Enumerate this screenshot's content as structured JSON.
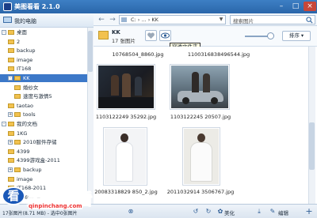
{
  "window": {
    "title": "美图看看 2.1.0"
  },
  "sidebar": {
    "header": "我的电脑",
    "items": [
      {
        "label": "桌面",
        "level": 0,
        "expander": "-"
      },
      {
        "label": "2",
        "level": 1,
        "expander": ""
      },
      {
        "label": "backup",
        "level": 1,
        "expander": ""
      },
      {
        "label": "image",
        "level": 1,
        "expander": ""
      },
      {
        "label": "IT168",
        "level": 1,
        "expander": ""
      },
      {
        "label": "KK",
        "level": 1,
        "expander": "-",
        "selected": true
      },
      {
        "label": "婚纱女",
        "level": 2,
        "expander": ""
      },
      {
        "label": "速度与激情5",
        "level": 2,
        "expander": ""
      },
      {
        "label": "taotao",
        "level": 1,
        "expander": ""
      },
      {
        "label": "tools",
        "level": 1,
        "expander": "+"
      },
      {
        "label": "我的文档",
        "level": 0,
        "expander": "-"
      },
      {
        "label": "1KG",
        "level": 1,
        "expander": ""
      },
      {
        "label": "2010服件存储",
        "level": 1,
        "expander": "+"
      },
      {
        "label": "4399",
        "level": 1,
        "expander": ""
      },
      {
        "label": "4399游戏盒-2011",
        "level": 1,
        "expander": ""
      },
      {
        "label": "backup",
        "level": 1,
        "expander": "+"
      },
      {
        "label": "image",
        "level": 1,
        "expander": ""
      },
      {
        "label": "IT168-2011",
        "level": 1,
        "expander": ""
      },
      {
        "label": "IT168图片",
        "level": 1,
        "expander": ""
      }
    ]
  },
  "toolbar": {
    "back": "←",
    "forward": "→",
    "address": "C: › ... › KK",
    "search_placeholder": "搜索图片"
  },
  "header": {
    "folder_name": "KK",
    "folder_count": "17 张图片",
    "sort_label": "排序 ▾",
    "tooltip": "穿透文件夹",
    "zoom_level": 0.9
  },
  "content": {
    "top_captions": [
      "10768504_8860.jpg",
      "1100316838496544.jpg"
    ],
    "photos": [
      {
        "caption": "1103122249 35292.jpg"
      },
      {
        "caption": "1103122245 20507.jpg"
      },
      {
        "caption": "20083318829 850_2.jpg"
      },
      {
        "caption": "2011032914 3506767.jpg"
      }
    ]
  },
  "statusbar": {
    "text": "17张图片(8.71 MB) - 选中0张图片",
    "share": "美化",
    "edit": "编辑"
  },
  "watermark": {
    "badge": "看",
    "text": "美图看看",
    "url": "qinpinchang.com"
  }
}
